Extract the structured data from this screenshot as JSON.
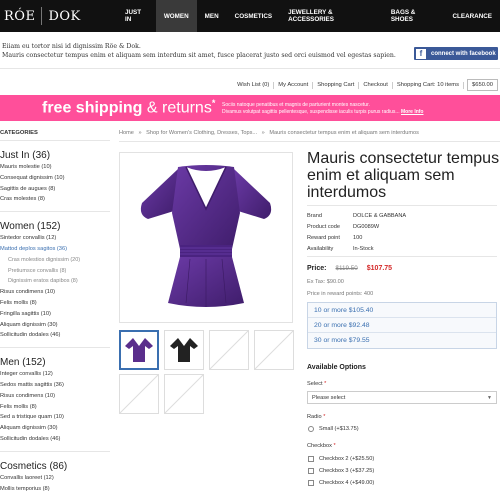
{
  "header": {
    "logo_left": "RÓE",
    "logo_right": "DOK",
    "nav": [
      "JUST IN",
      "WOMEN",
      "MEN",
      "COSMETICS",
      "JEWELLERY & ACCESSORIES",
      "BAGS & SHOES",
      "CLEARANCE"
    ],
    "active_nav": "WOMEN"
  },
  "intro": {
    "line1": "Eiiam eu tortor nisi id dignissim Röe & Dok.",
    "line2": "Mauris consectetur tempus enim et aliquam sem interdum sit amet, fusce placerat justo sed orci euismod vel egestas sapien."
  },
  "facebook": {
    "icon": "f",
    "label": "connect with facebook"
  },
  "account": {
    "links": [
      "Wish List (0)",
      "My Account",
      "Shopping Cart",
      "Checkout"
    ],
    "cart_summary": "Shopping Cart: 10 items",
    "cart_total": "$650.00"
  },
  "banner": {
    "title_bold": "free shipping",
    "title_thin": "& returns",
    "star": "*",
    "text1": "Sociis natoque penatibus et magnis de parturient montes nascetur.",
    "text2": "Divamus volutpat sagittis pellentesque, suspendisse iaculis turpis purus radius...",
    "more": "More Info"
  },
  "breadcrumb": {
    "items": [
      "Home",
      "Shop for Women's Clothing, Dresses, Tops...",
      "Mauris consectetur tempus enim et aliquam sem interdumos"
    ],
    "separator": "»"
  },
  "sidebar": {
    "title": "CATEGORIES",
    "groups": [
      {
        "heading": "Just In (36)",
        "items": [
          {
            "label": "Mauris molestie (10)"
          },
          {
            "label": "Consequat dignissim (10)"
          },
          {
            "label": "Sagittis de augues (8)"
          },
          {
            "label": "Cras molestes (8)"
          }
        ]
      },
      {
        "heading": "Women (152)",
        "items": [
          {
            "label": "Sintedor convallis (12)"
          },
          {
            "label": "Mattod deplos sagitos (36)",
            "selected": true
          },
          {
            "label": "Cras molestios dignissim (20)",
            "sub": true
          },
          {
            "label": "Pretiumsce convallis (8)",
            "sub": true
          },
          {
            "label": "Dignissim eratos dapibos (8)",
            "sub": true
          },
          {
            "label": "Risus condimens (10)"
          },
          {
            "label": "Felis mollis (8)"
          },
          {
            "label": "Fringilla sagittis (10)"
          },
          {
            "label": "Aliquam dignissim (30)"
          },
          {
            "label": "Sollicitudin dodales (46)"
          }
        ]
      },
      {
        "heading": "Men (152)",
        "items": [
          {
            "label": "Integer convallis (12)"
          },
          {
            "label": "Sedos mattis sagittis (36)"
          },
          {
            "label": "Risus condimens (10)"
          },
          {
            "label": "Felis mollis (8)"
          },
          {
            "label": "Sed a tristique quam (10)"
          },
          {
            "label": "Aliquam dignissim (30)"
          },
          {
            "label": "Sollicitudin dodales (46)"
          }
        ]
      },
      {
        "heading": "Cosmetics (86)",
        "items": [
          {
            "label": "Convallis laoreet (12)"
          },
          {
            "label": "Mollis temporius (8)"
          }
        ]
      }
    ]
  },
  "product": {
    "title": "Mauris consectetur tempus enim et aliquam sem interdumos",
    "specs": [
      {
        "key": "Brand",
        "value": "DOLCE & GABBANA"
      },
      {
        "key": "Product code",
        "value": "DG0089W"
      },
      {
        "key": "Reward point",
        "value": "100"
      },
      {
        "key": "Availability",
        "value": "In-Stock"
      }
    ],
    "price_label": "Price:",
    "old_price": "$119.50",
    "new_price": "$107.75",
    "ex_tax": "Ex Tax: $90.00",
    "reward_price": "Price in reward points: 400",
    "tiers": [
      "10 or more $105.40",
      "20 or more $92.48",
      "30 or more $79.55"
    ],
    "options_heading": "Available Options",
    "select_label": "Select",
    "select_value": "Please select",
    "radio_label": "Radio",
    "radio_option": "Small (+$13.75)",
    "checkbox_label": "Checkbox",
    "checkboxes": [
      "Checkbox 2 (+$25.50)",
      "Checkbox 3 (+$37.25)",
      "Checkbox 4 (+$49.00)"
    ],
    "required_mark": "*"
  },
  "colors": {
    "accent_blue": "#3a6fb0",
    "banner_pink": "#ff4f9a",
    "sale_red": "#d42727",
    "dress_purple": "#5a2e8c"
  }
}
